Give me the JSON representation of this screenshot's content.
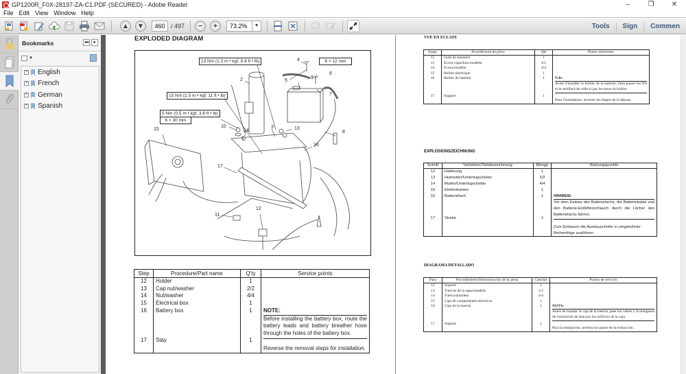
{
  "window": {
    "title": "GP1200R_F0X-28197-ZA-C1.PDF (SECURED) - Adobe Reader",
    "controls": [
      "–",
      "❐",
      "✕"
    ]
  },
  "menu": [
    "File",
    "Edit",
    "View",
    "Window",
    "Help"
  ],
  "toolbar": {
    "icons": [
      "create-pdf-icon",
      "open-icon",
      "edit-icon",
      "upload-cloud-icon",
      "save-icon",
      "print-icon",
      "email-icon"
    ],
    "prev_page": "▲",
    "next_page": "▼",
    "current_page": "460",
    "total_pages": "/ 497",
    "zoom_out": "−",
    "zoom_in": "+",
    "zoom_value": "73.2%",
    "right_links": [
      "Tools",
      "Sign",
      "Commen"
    ]
  },
  "bookmarks": {
    "header": "Bookmarks",
    "items": [
      {
        "label": "English"
      },
      {
        "label": "French"
      },
      {
        "label": "German"
      },
      {
        "label": "Spanish"
      }
    ]
  },
  "english_page": {
    "heading": "EXPLODED DIAGRAM",
    "diagram": {
      "torque_labels": [
        "13 Nm (1.3 m • kgf, 9.4 ft • lb)",
        "15 Nm (1.5 m • kgf, 11 ft • lb)",
        "5 Nm (0.5 m • kgf, 3.6 ft • lb)"
      ],
      "size_labels": [
        "6 × 12 mm",
        "6 × 30 mm"
      ],
      "callouts": [
        "1",
        "2",
        "3",
        "4",
        "5",
        "6",
        "7",
        "8",
        "9",
        "10",
        "11",
        "12",
        "13",
        "14",
        "15",
        "16",
        "17"
      ]
    },
    "table": {
      "headers": [
        "Step",
        "Procedure/Part name",
        "Q'ty",
        "Service points"
      ],
      "rows": [
        {
          "step": "12",
          "name": "Holder",
          "qty": "1"
        },
        {
          "step": "13",
          "name": "Cap nut/washer",
          "qty": "2/2"
        },
        {
          "step": "14",
          "name": "Nut/washer",
          "qty": "4/4"
        },
        {
          "step": "15",
          "name": "Electrical box",
          "qty": "1"
        },
        {
          "step": "16",
          "name": "Battery box",
          "qty": "1"
        },
        {
          "step": "17",
          "name": "Stay",
          "qty": "1"
        }
      ],
      "note_title": "NOTE:",
      "note_body": "Before installing the battery box, route the battery leads and battery breather hose through the holes of the battery box.",
      "footer": "Reverse the removal steps for installation."
    }
  },
  "french": {
    "heading": "VUE EN ECLATE",
    "headers": [
      "Etape",
      "Procédé/nom de pièce",
      "Qté",
      "Points d'entretien"
    ],
    "rows": [
      {
        "step": "12",
        "name": "Outil de maintien",
        "qty": "1"
      },
      {
        "step": "13",
        "name": "Ecrou-capuchon/rondelle",
        "qty": "2/2"
      },
      {
        "step": "14",
        "name": "Ecrou/rondelle",
        "qty": "4/4"
      },
      {
        "step": "15",
        "name": "Boîtier électrique",
        "qty": "1"
      },
      {
        "step": "16",
        "name": "Boîtier de batterie",
        "qty": "1"
      },
      {
        "step": "17",
        "name": "Support",
        "qty": "1"
      }
    ],
    "note_title": "N.B.:",
    "note_body": "Avant d'installer le boîtier de la batterie, faire passer les fils et le reniflard de celle-ci par les trous du boîtier.",
    "footer": "Pour l'installation, inverser les étapes de la dépose."
  },
  "german": {
    "heading": "EXPLOSIONSZEICHNUNG",
    "headers": [
      "Schritt",
      "Verfahren/Teilebezeichnung",
      "Menge",
      "Wartungspunkte"
    ],
    "rows": [
      {
        "step": "12",
        "name": "Halterung",
        "qty": "1"
      },
      {
        "step": "13",
        "name": "Hutmutter/Unterlegscheibe",
        "qty": "2/2"
      },
      {
        "step": "14",
        "name": "Mutter/Unterlegscheibe",
        "qty": "4/4"
      },
      {
        "step": "15",
        "name": "Elektrokasten",
        "qty": "1"
      },
      {
        "step": "16",
        "name": "Batteriefach",
        "qty": "1"
      },
      {
        "step": "17",
        "name": "Strebe",
        "qty": "1"
      }
    ],
    "note_title": "HINWEIS:",
    "note_body": "Vor dem Einbau des Batteriefachs, die Batteriekabel und den Batterie-Entlüfterschlauch durch die Löcher des Batteriefachs führen.",
    "footer": "Zum Einbauen die Ausbauschritte in umgekehrter Reihenfolge ausführen."
  },
  "spanish": {
    "heading": "DIAGRAMA DETALLADO",
    "headers": [
      "Paso",
      "Procedimiento/Denominación de la pieza",
      "Cantidad",
      "Puntos de servicio"
    ],
    "rows": [
      {
        "step": "12",
        "name": "Soporte",
        "qty": "1"
      },
      {
        "step": "13",
        "name": "Tuercas de la tapa/arandela",
        "qty": "2/2"
      },
      {
        "step": "14",
        "name": "Tuerca/arandela",
        "qty": "4/4"
      },
      {
        "step": "15",
        "name": "Caja de componentes eléctricos",
        "qty": "1"
      },
      {
        "step": "16",
        "name": "Caja de la batería",
        "qty": "1"
      },
      {
        "step": "17",
        "name": "Soporte",
        "qty": "1"
      }
    ],
    "note_title": "NOTA:",
    "note_body": "Antes de instalar la caja de la batería, pase los cables y la manguera de ventilación de ésta por los orificios de la caja.",
    "footer": "Para la instalación, invierta los pasos de la extracción."
  }
}
